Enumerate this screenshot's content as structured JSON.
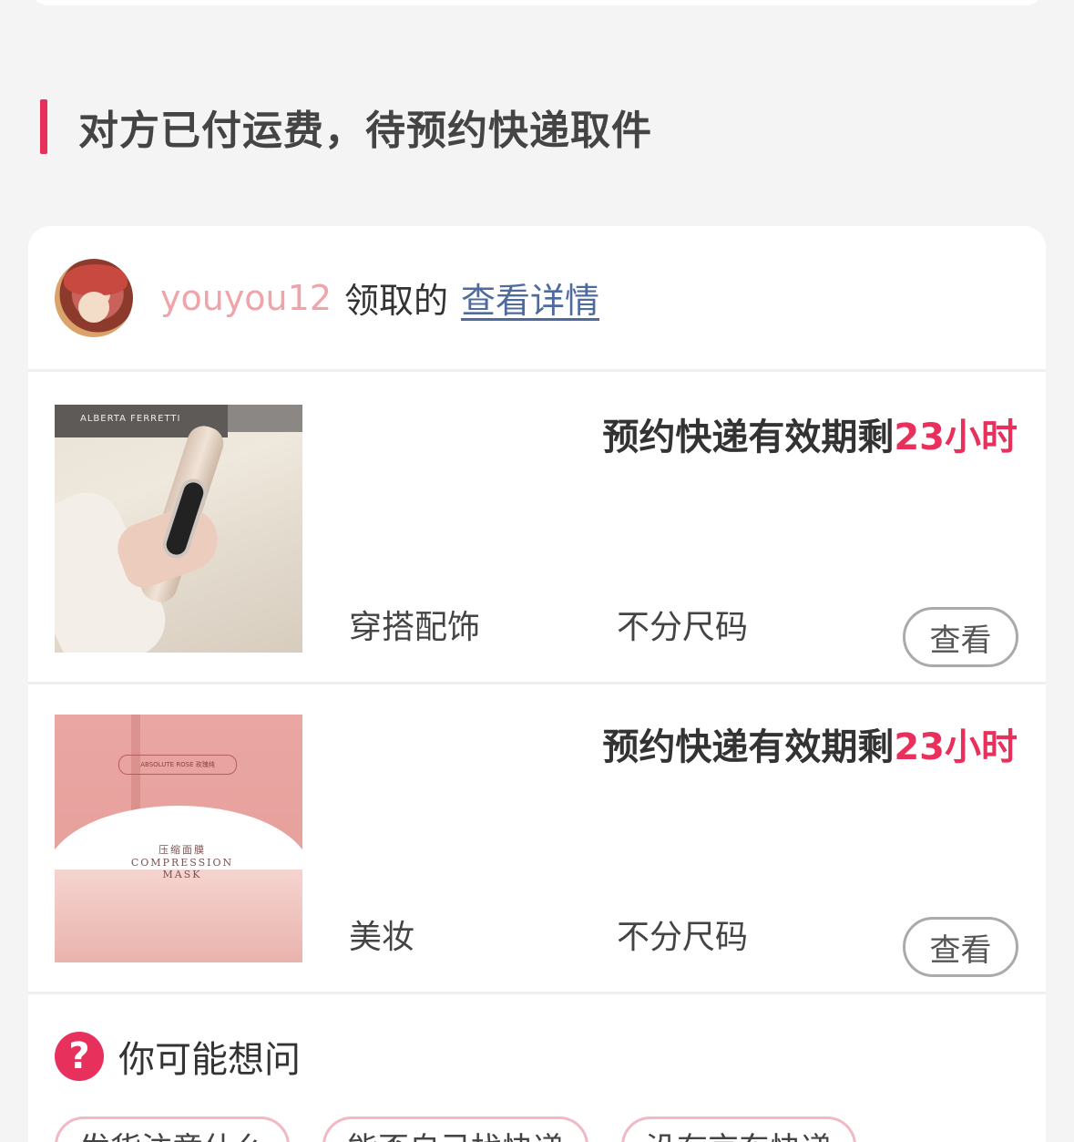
{
  "section": {
    "title": "对方已付运费，待预约快递取件"
  },
  "claim": {
    "user": "youyou12",
    "text": "领取的",
    "link": "查看详情"
  },
  "items": [
    {
      "deadline_prefix": "预约快递有效期剩",
      "deadline_value": "23小时",
      "category": "穿搭配饰",
      "size": "不分尺码",
      "view_label": "查看",
      "image_caption": "ALBERTA FERRETTI"
    },
    {
      "deadline_prefix": "预约快递有效期剩",
      "deadline_value": "23小时",
      "category": "美妆",
      "size": "不分尺码",
      "view_label": "查看",
      "image_caption": "压缩面膜 COMPRESSION MASK",
      "image_brand": "ABSOLUTE ROSE 玫瑰纯"
    }
  ],
  "faq": {
    "icon_glyph": "?",
    "title": "你可能想问",
    "chips": [
      "发货注意什么",
      "能否自己找快递",
      "没有京东快递"
    ]
  },
  "colors": {
    "accent": "#e8305d",
    "link": "#4f6b9e",
    "username": "#f0a3a8"
  }
}
